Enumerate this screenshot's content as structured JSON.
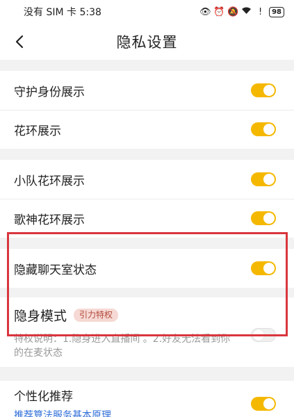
{
  "status_bar": {
    "carrier_time": "没有 SIM 卡 5:38",
    "battery": "98",
    "icons": [
      "eye-icon",
      "alarm-icon",
      "mute-icon",
      "wifi-icon",
      "sim-alert-icon",
      "battery-icon"
    ]
  },
  "header": {
    "title": "隐私设置",
    "back_icon": "chevron-left-icon"
  },
  "groups": [
    {
      "items": [
        {
          "label": "守护身份展示",
          "on": true
        },
        {
          "label": "花环展示",
          "on": true
        }
      ]
    },
    {
      "items": [
        {
          "label": "小队花环展示",
          "on": true
        },
        {
          "label": "歌神花环展示",
          "on": true
        }
      ]
    }
  ],
  "hide_chatroom": {
    "label": "隐藏聊天室状态",
    "on": true
  },
  "stealth": {
    "label": "隐身模式",
    "badge": "引力特权",
    "description": "特权说明：1.隐身进入直播间 。2.好友无法看到你的在麦状态",
    "on": false
  },
  "personalized": {
    "label": "个性化推荐",
    "link": "推荐算法服务基本原理",
    "on": true
  },
  "colors": {
    "accent": "#f5b800",
    "highlight": "#d9363e",
    "link": "#2f6ed8",
    "badge_bg": "#f6d9d4"
  }
}
